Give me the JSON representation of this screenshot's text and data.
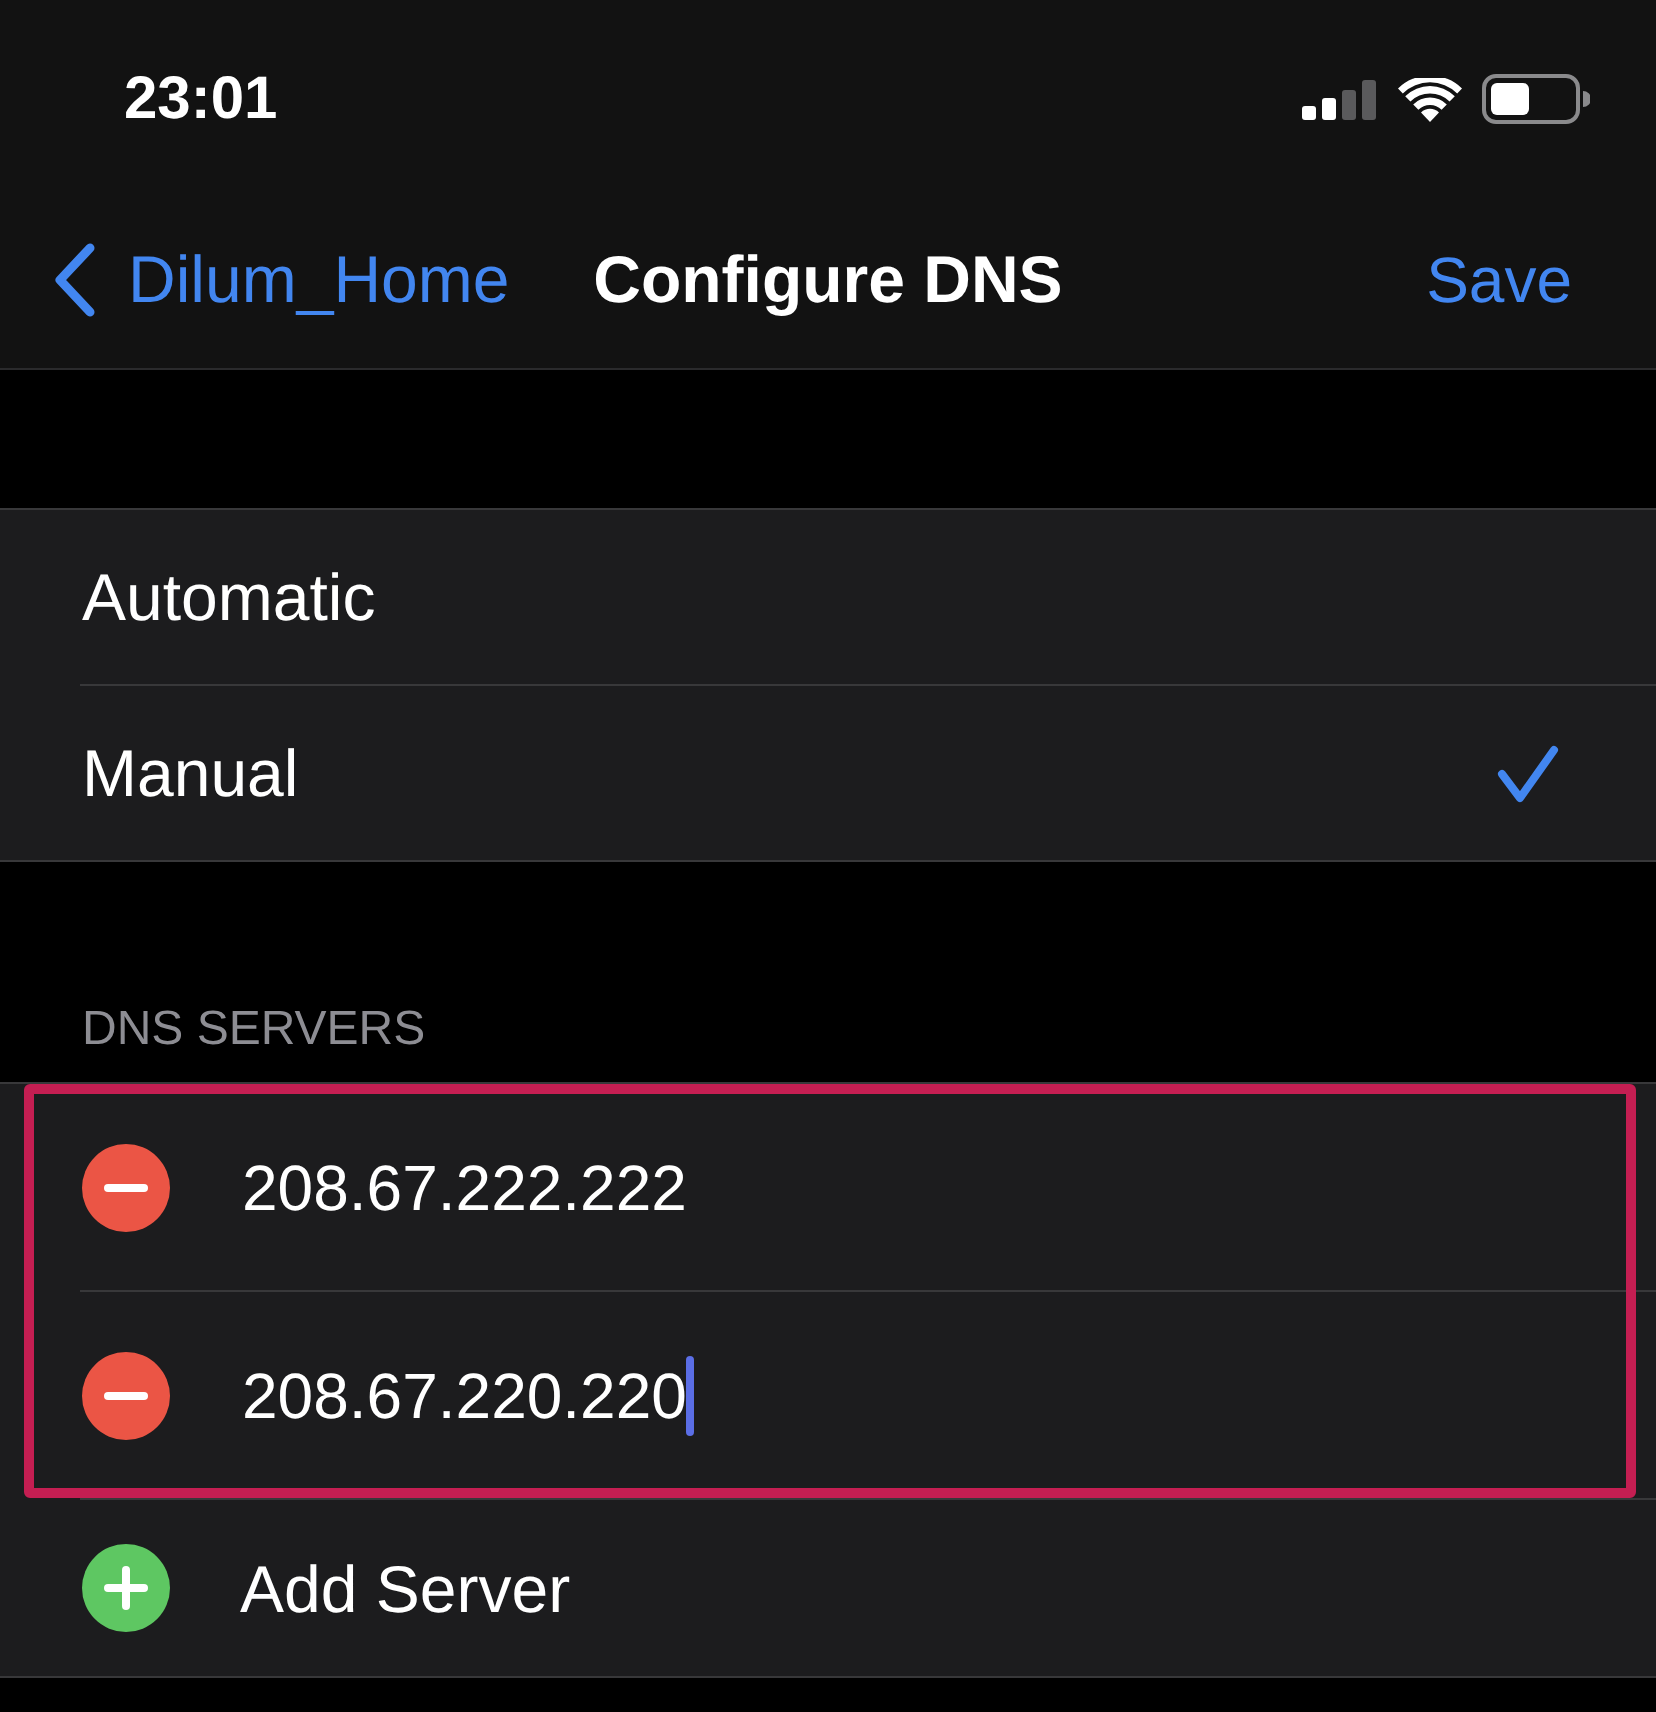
{
  "status_bar": {
    "time": "23:01"
  },
  "nav": {
    "back_label": "Dilum_Home",
    "title": "Configure DNS",
    "action": "Save"
  },
  "mode_options": [
    {
      "label": "Automatic",
      "selected": false
    },
    {
      "label": "Manual",
      "selected": true
    }
  ],
  "dns_servers": {
    "header": "DNS SERVERS",
    "highlighted": true,
    "servers": [
      {
        "address": "208.67.222.222",
        "focused": false
      },
      {
        "address": "208.67.220.220",
        "focused": true
      }
    ],
    "add_label": "Add Server"
  }
}
